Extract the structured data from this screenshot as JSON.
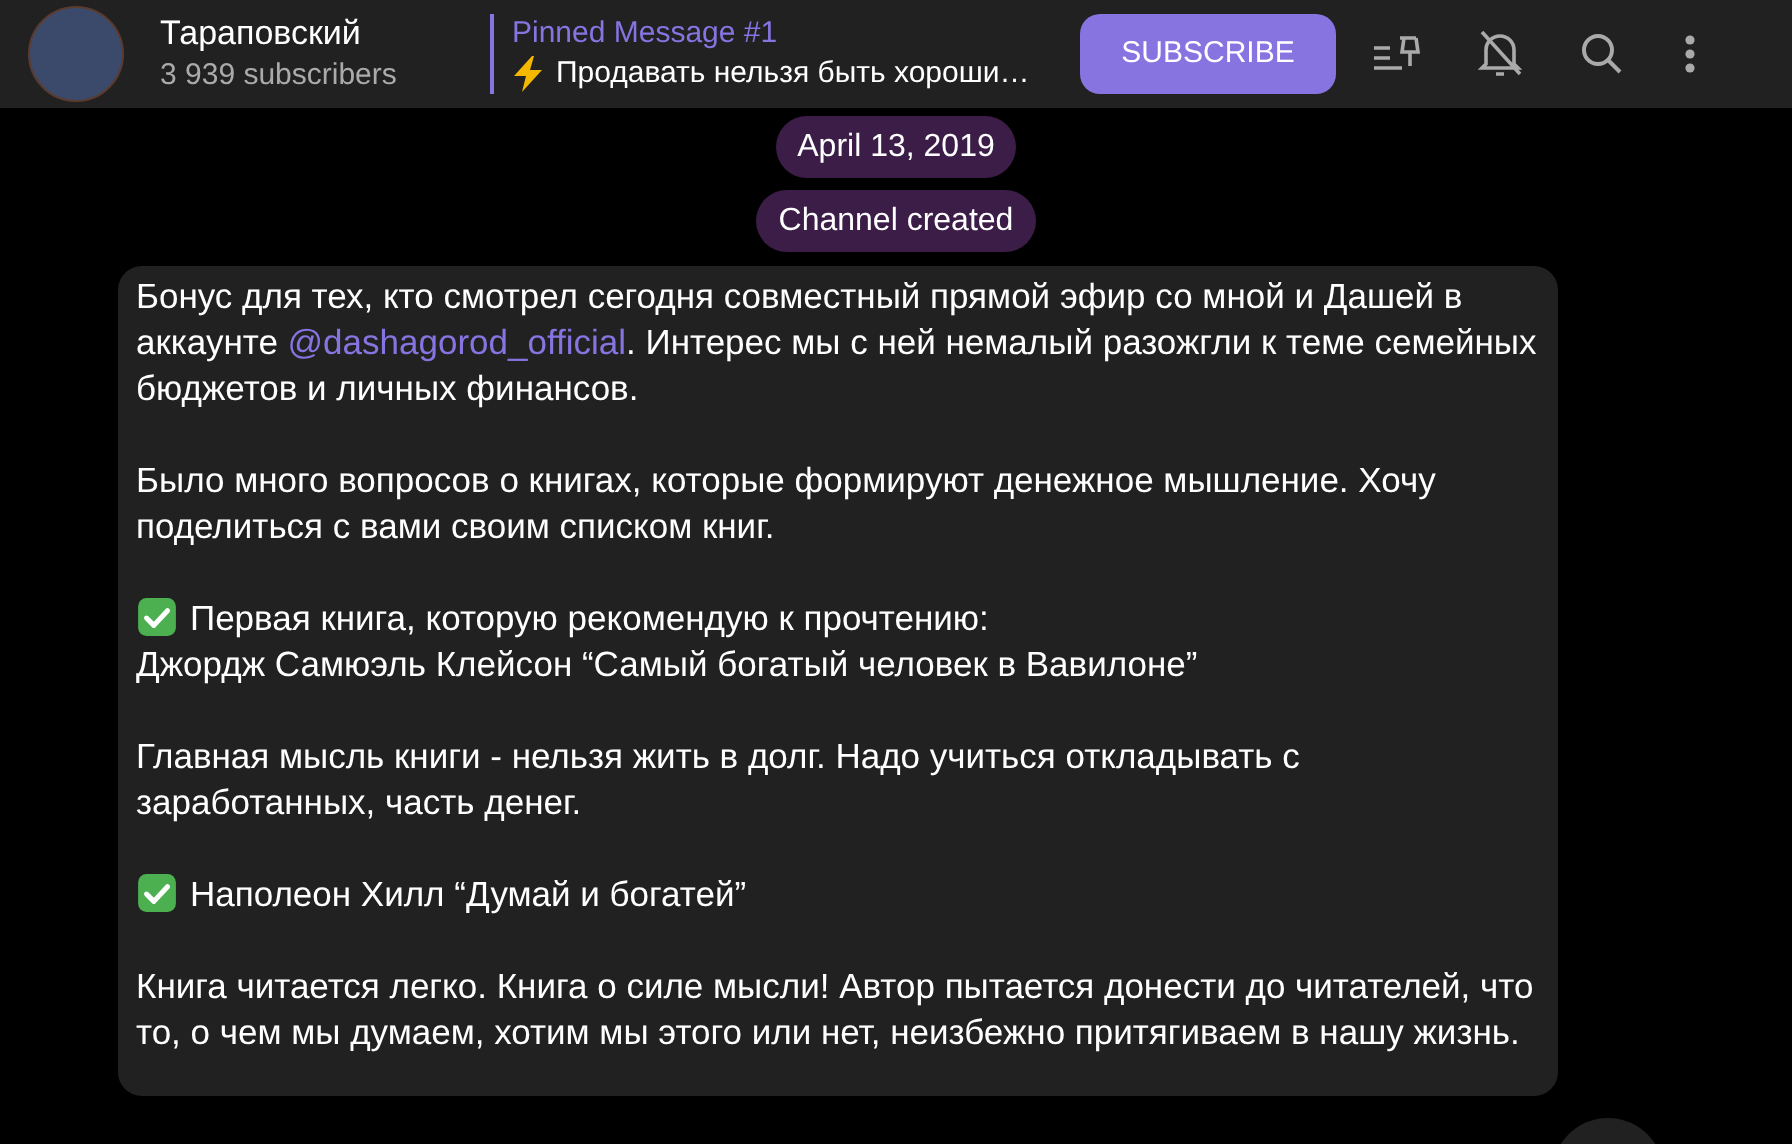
{
  "header": {
    "channel_name": "Тараповский",
    "subscribers": "3 939 subscribers",
    "pinned": {
      "title": "Pinned Message #1",
      "text": "Продавать нельзя быть хороши…"
    },
    "subscribe_button": "SUBSCRIBE",
    "notifications_muted": true
  },
  "service_messages": [
    {
      "text": "April 13, 2019"
    },
    {
      "text": "Channel created"
    }
  ],
  "message": {
    "paragraphs": [
      {
        "kind": "text",
        "before": "Бонус для тех, кто смотрел сегодня совместный прямой эфир со мной и Дашей в аккаунте ",
        "link": "@dashagorod_official",
        "after": ". Интерес мы с ней немалый разожгли к теме семейных бюджетов и личных финансов."
      },
      {
        "kind": "text",
        "before": "Было много вопросов о книгах, которые формируют денежное мышление. Хочу поделиться с вами своим списком книг."
      },
      {
        "kind": "check",
        "before": "Первая книга, которую рекомендую к прочтению:\nДжордж Самюэль Клейсон “Самый богатый человек в Вавилоне”"
      },
      {
        "kind": "text",
        "before": "Главная мысль книги - нельзя жить в долг. Надо учиться откладывать с заработанных, часть денег."
      },
      {
        "kind": "check",
        "before": "Наполеон Хилл “Думай и богатей”"
      },
      {
        "kind": "text",
        "before": "Книга читается легко. Книга о силе мысли! Автор пытается донести до читателей, что то, о чем мы думаем, хотим мы этого или нет, неизбежно притягиваем в нашу жизнь."
      }
    ]
  }
}
